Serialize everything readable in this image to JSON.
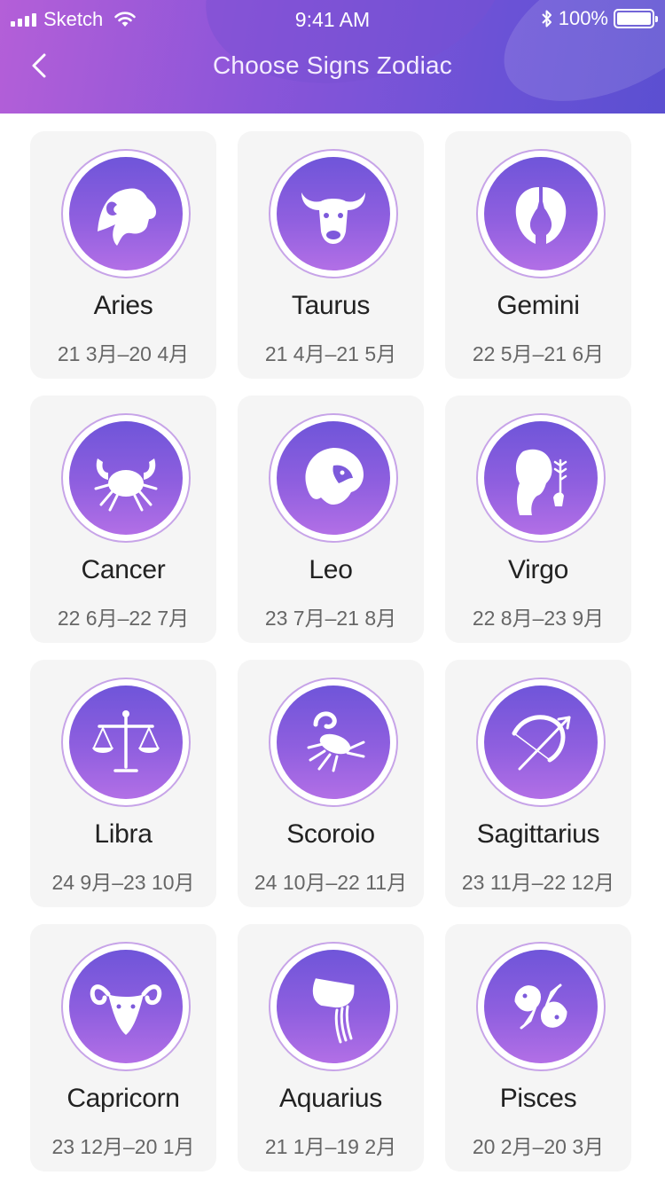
{
  "status_bar": {
    "carrier": "Sketch",
    "time": "9:41 AM",
    "battery": "100%"
  },
  "nav": {
    "title": "Choose Signs Zodiac"
  },
  "colors": {
    "header_gradient_start": "#b45fd8",
    "header_gradient_end": "#5b4fd1",
    "badge_gradient_top": "#6f55d9",
    "badge_gradient_bottom": "#b26fe6",
    "card_bg": "#f5f5f5"
  },
  "signs": [
    {
      "name": "Aries",
      "dates": "21 3月–20 4月",
      "icon": "ram-icon"
    },
    {
      "name": "Taurus",
      "dates": "21 4月–21 5月",
      "icon": "bull-icon"
    },
    {
      "name": "Gemini",
      "dates": "22 5月–21 6月",
      "icon": "twins-icon"
    },
    {
      "name": "Cancer",
      "dates": "22 6月–22 7月",
      "icon": "crab-icon"
    },
    {
      "name": "Leo",
      "dates": "23 7月–21 8月",
      "icon": "lion-icon"
    },
    {
      "name": "Virgo",
      "dates": "22 8月–23 9月",
      "icon": "maiden-icon"
    },
    {
      "name": "Libra",
      "dates": "24 9月–23 10月",
      "icon": "scales-icon"
    },
    {
      "name": "Scoroio",
      "dates": "24 10月–22 11月",
      "icon": "scorpion-icon"
    },
    {
      "name": "Sagittarius",
      "dates": "23 11月–22 12月",
      "icon": "bow-arrow-icon"
    },
    {
      "name": "Capricorn",
      "dates": "23 12月–20 1月",
      "icon": "goat-icon"
    },
    {
      "name": "Aquarius",
      "dates": "21 1月–19 2月",
      "icon": "water-jar-icon"
    },
    {
      "name": "Pisces",
      "dates": "20 2月–20 3月",
      "icon": "fish-icon"
    }
  ]
}
